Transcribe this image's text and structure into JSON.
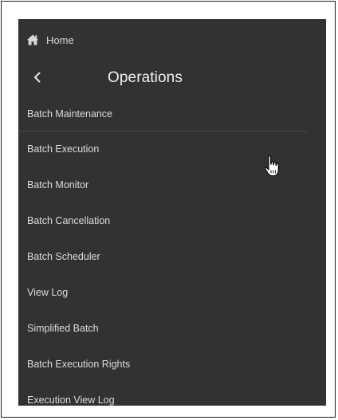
{
  "home": {
    "icon": "home-icon",
    "label": "Home"
  },
  "header": {
    "back_icon": "chevron-left-icon",
    "title": "Operations"
  },
  "menu": {
    "items": [
      {
        "label": "Batch Maintenance"
      },
      {
        "label": "Batch Execution"
      },
      {
        "label": "Batch Monitor"
      },
      {
        "label": "Batch Cancellation"
      },
      {
        "label": "Batch Scheduler"
      },
      {
        "label": "View Log"
      },
      {
        "label": "Simplified Batch"
      },
      {
        "label": "Batch Execution Rights"
      },
      {
        "label": "Execution View Log"
      }
    ]
  },
  "pointer": {
    "icon": "hand-pointer-icon"
  },
  "colors": {
    "panel_background": "#323232",
    "text": "#dcdcdc",
    "separator": "#4a4a4a"
  }
}
